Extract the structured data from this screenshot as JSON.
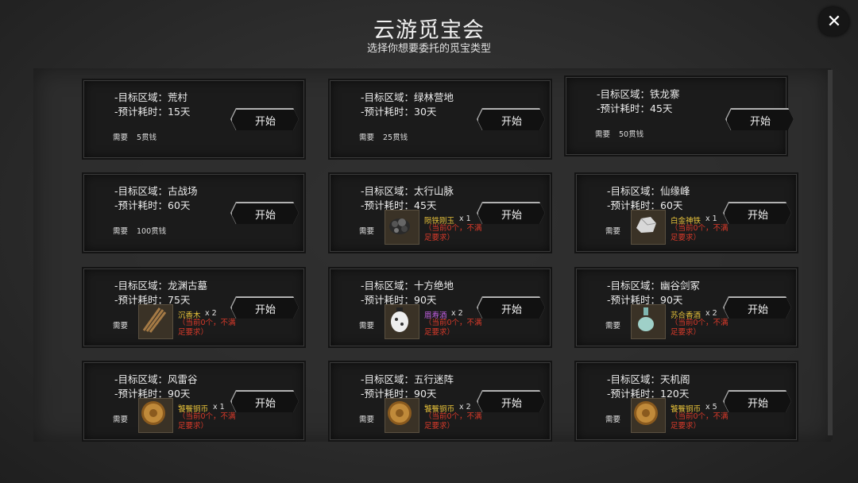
{
  "header": {
    "title": "云游觅宝会",
    "subtitle": "选择你想要委托的觅宝类型"
  },
  "close_label": "✕",
  "labels": {
    "zone_prefix": "-目标区域：",
    "time_prefix": "-预计耗时：",
    "need": "需要",
    "start": "开始",
    "warn": "（当前0个，不满足要求）"
  },
  "cards": [
    {
      "zone": "-目标区域：荒村",
      "time": "-预计耗时：15天",
      "need": "需要",
      "cost": "5贯钱",
      "start": "开始"
    },
    {
      "zone": "-目标区域：绿林营地",
      "time": "-预计耗时：30天",
      "need": "需要",
      "cost": "25贯钱",
      "start": "开始"
    },
    {
      "zone": "-目标区域：铁龙寨",
      "time": "-预计耗时：45天",
      "need": "需要",
      "cost": "50贯钱",
      "start": "开始"
    },
    {
      "zone": "-目标区域：古战场",
      "time": "-预计耗时：60天",
      "need": "需要",
      "cost": "100贯钱",
      "start": "开始"
    },
    {
      "zone": "-目标区域：太行山脉",
      "time": "-预计耗时：45天",
      "need": "需要",
      "item": "陨铁刚玉",
      "qty": "x 1",
      "color": "#e8c23a",
      "icon": "ore-icon",
      "warn": "（当前0个，不满足要求）",
      "start": "开始"
    },
    {
      "zone": "-目标区域：仙缘峰",
      "time": "-预计耗时：60天",
      "need": "需要",
      "item": "白金神铁",
      "qty": "x 1",
      "color": "#e8c23a",
      "icon": "platinum-icon",
      "warn": "（当前0个，不满足要求）",
      "start": "开始"
    },
    {
      "zone": "-目标区域：龙渊古墓",
      "time": "-预计耗时：75天",
      "need": "需要",
      "item": "沉香木",
      "qty": "x 2",
      "color": "#e8c23a",
      "icon": "wood-icon",
      "warn": "（当前0个，不满足要求）",
      "start": "开始"
    },
    {
      "zone": "-目标区域：十方绝地",
      "time": "-预计耗时：90天",
      "need": "需要",
      "item": "眉寿酒",
      "qty": "x 2",
      "color": "#c060e0",
      "icon": "wine-jar-icon",
      "warn": "（当前0个，不满足要求）",
      "start": "开始"
    },
    {
      "zone": "-目标区域：幽谷剑冢",
      "time": "-预计耗时：90天",
      "need": "需要",
      "item": "苏合香酒",
      "qty": "x 2",
      "color": "#e8c23a",
      "icon": "wine-bottle-icon",
      "warn": "（当前0个，不满足要求）",
      "start": "开始"
    },
    {
      "zone": "-目标区域：风雷谷",
      "time": "-预计耗时：90天",
      "need": "需要",
      "item": "饕餮铜币",
      "qty": "x 1",
      "color": "#e8c23a",
      "icon": "coin-icon",
      "warn": "（当前0个，不满足要求）",
      "start": "开始"
    },
    {
      "zone": "-目标区域：五行迷阵",
      "time": "-预计耗时：90天",
      "need": "需要",
      "item": "饕餮铜币",
      "qty": "x 2",
      "color": "#e8c23a",
      "icon": "coin-icon",
      "warn": "（当前0个，不满足要求）",
      "start": "开始"
    },
    {
      "zone": "-目标区域：天机阁",
      "time": "-预计耗时：120天",
      "need": "需要",
      "item": "饕餮铜币",
      "qty": "x 5",
      "color": "#e8c23a",
      "icon": "coin-icon",
      "warn": "（当前0个，不满足要求）",
      "start": "开始"
    }
  ]
}
